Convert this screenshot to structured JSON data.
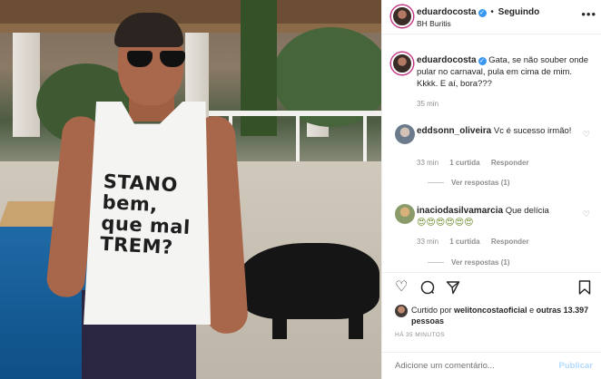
{
  "post": {
    "author": "eduardocosta",
    "status": "Seguindo",
    "location": "BH Buritis",
    "photo_text": [
      "STANO",
      "bem,",
      "que mal",
      "TREM?"
    ]
  },
  "caption": {
    "username": "eduardocosta",
    "text": "Gata, se não souber onde pular no carnaval, pula em cima de mim. Kkkk. E aí, bora???",
    "time": "35 min"
  },
  "comments": [
    {
      "username": "eddsonn_oliveira",
      "text": "Vc é sucesso irmão!",
      "time": "33 min",
      "likes": "1 curtida",
      "reply": "Responder",
      "view_replies": "Ver respostas (1)"
    },
    {
      "username": "inaciodasilvamarcia",
      "text": "Que delícia",
      "emoji": "😍😍😍😍😍😍",
      "time": "33 min",
      "likes": "1 curtida",
      "reply": "Responder",
      "view_replies": "Ver respostas (1)"
    }
  ],
  "likes": {
    "prefix": "Curtido por",
    "user": "welitoncostaoficial",
    "and": "e",
    "others": "outras 13.397 pessoas"
  },
  "timestamp": "HÁ 35 MINUTOS",
  "add_comment": {
    "placeholder": "Adicione um comentário...",
    "publish": "Publicar"
  },
  "colors": {
    "verified": "#3897f0",
    "publish_disabled": "#b3dbff",
    "meta_grey": "#8e8e8e"
  }
}
